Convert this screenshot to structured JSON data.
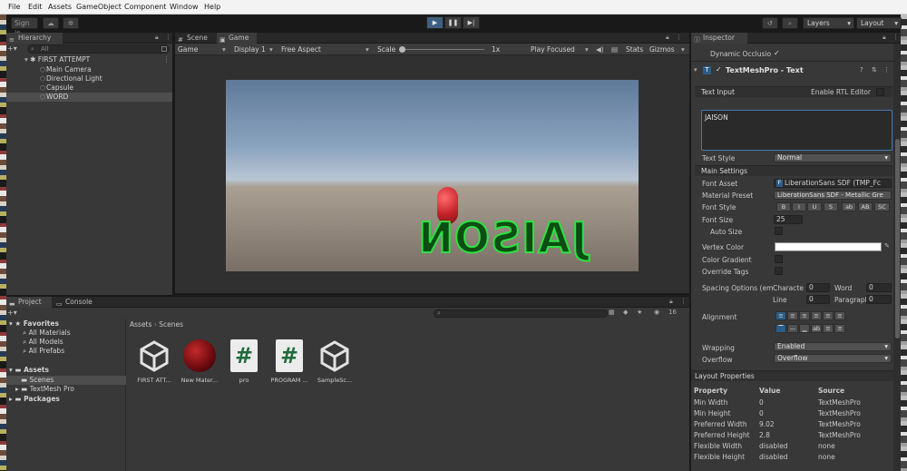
{
  "menubar": {
    "items": [
      "File",
      "Edit",
      "Assets",
      "GameObject",
      "Component",
      "Window",
      "Help"
    ]
  },
  "toolbar": {
    "sign_in": "Sign in",
    "layers_label": "Layers",
    "layout_label": "Layout",
    "play_icon": "play-icon",
    "pause_icon": "pause-icon",
    "step_icon": "step-icon"
  },
  "hierarchy": {
    "tab_label": "Hierarchy",
    "search_placeholder": "All",
    "scene_name": "FIRST ATTEMPT",
    "items": [
      "Main Camera",
      "Directional Light",
      "Capsule",
      "WORD"
    ]
  },
  "game": {
    "tabs": [
      "Scene",
      "Game"
    ],
    "display_mode": "Game",
    "display": "Display 1",
    "aspect": "Free Aspect",
    "scale_label": "Scale",
    "scale_value": "1x",
    "play_focused": "Play Focused",
    "stats": "Stats",
    "gizmos": "Gizmos",
    "rendered_text": "JAISON"
  },
  "project": {
    "tabs": [
      "Project",
      "Console"
    ],
    "favorites_label": "Favorites",
    "favorites": [
      "All Materials",
      "All Models",
      "All Prefabs"
    ],
    "assets_label": "Assets",
    "asset_children": [
      "Scenes",
      "TextMesh Pro"
    ],
    "packages_label": "Packages",
    "breadcrumb": [
      "Assets",
      "Scenes"
    ],
    "count_badge": "16",
    "assets": [
      {
        "label": "FIRST ATT...",
        "icon": "unity-scene-icon"
      },
      {
        "label": "New Mater...",
        "icon": "material-sphere-icon"
      },
      {
        "label": "pro",
        "icon": "csharp-script-icon"
      },
      {
        "label": "PROGRAM ...",
        "icon": "csharp-script-icon"
      },
      {
        "label": "SampleSc...",
        "icon": "unity-scene-icon"
      }
    ]
  },
  "inspector": {
    "tab_label": "Inspector",
    "dynamic_occlusion_label": "Dynamic Occlusio",
    "component_title": "TextMeshPro - Text",
    "text_input_label": "Text Input",
    "enable_rtl_label": "Enable RTL Editor",
    "text_value": "JAISON",
    "text_style_label": "Text Style",
    "text_style_value": "Normal",
    "main_settings_label": "Main Settings",
    "font_asset_label": "Font Asset",
    "font_asset_value": "LiberationSans SDF (TMP_Fc",
    "material_preset_label": "Material Preset",
    "material_preset_value": "LiberationSans SDF - Metallic Gre",
    "font_style_label": "Font Style",
    "font_style_buttons": [
      "B",
      "I",
      "U",
      "S",
      "ab",
      "AB",
      "SC"
    ],
    "font_size_label": "Font Size",
    "font_size_value": "25",
    "auto_size_label": "Auto Size",
    "vertex_color_label": "Vertex Color",
    "color_gradient_label": "Color Gradient",
    "override_tags_label": "Override Tags",
    "spacing_label": "Spacing Options (em",
    "spacing": {
      "character_label": "Characte",
      "character_value": "0",
      "word_label": "Word",
      "word_value": "0",
      "line_label": "Line",
      "line_value": "0",
      "paragraph_label": "Paragrapl",
      "paragraph_value": "0"
    },
    "alignment_label": "Alignment",
    "wrapping_label": "Wrapping",
    "wrapping_value": "Enabled",
    "overflow_label": "Overflow",
    "overflow_value": "Overflow",
    "layout_properties_label": "Layout Properties",
    "layout_headers": [
      "Property",
      "Value",
      "Source"
    ],
    "layout_rows": [
      [
        "Min Width",
        "0",
        "TextMeshPro"
      ],
      [
        "Min Height",
        "0",
        "TextMeshPro"
      ],
      [
        "Preferred Width",
        "9.02",
        "TextMeshPro"
      ],
      [
        "Preferred Height",
        "2.8",
        "TextMeshPro"
      ],
      [
        "Flexible Width",
        "disabled",
        "none"
      ],
      [
        "Flexible Height",
        "disabled",
        "none"
      ]
    ]
  },
  "colors": {
    "accent_blue": "#2c5d87",
    "text_green": "#22d13a",
    "selected_row": "#4d4d4d"
  }
}
